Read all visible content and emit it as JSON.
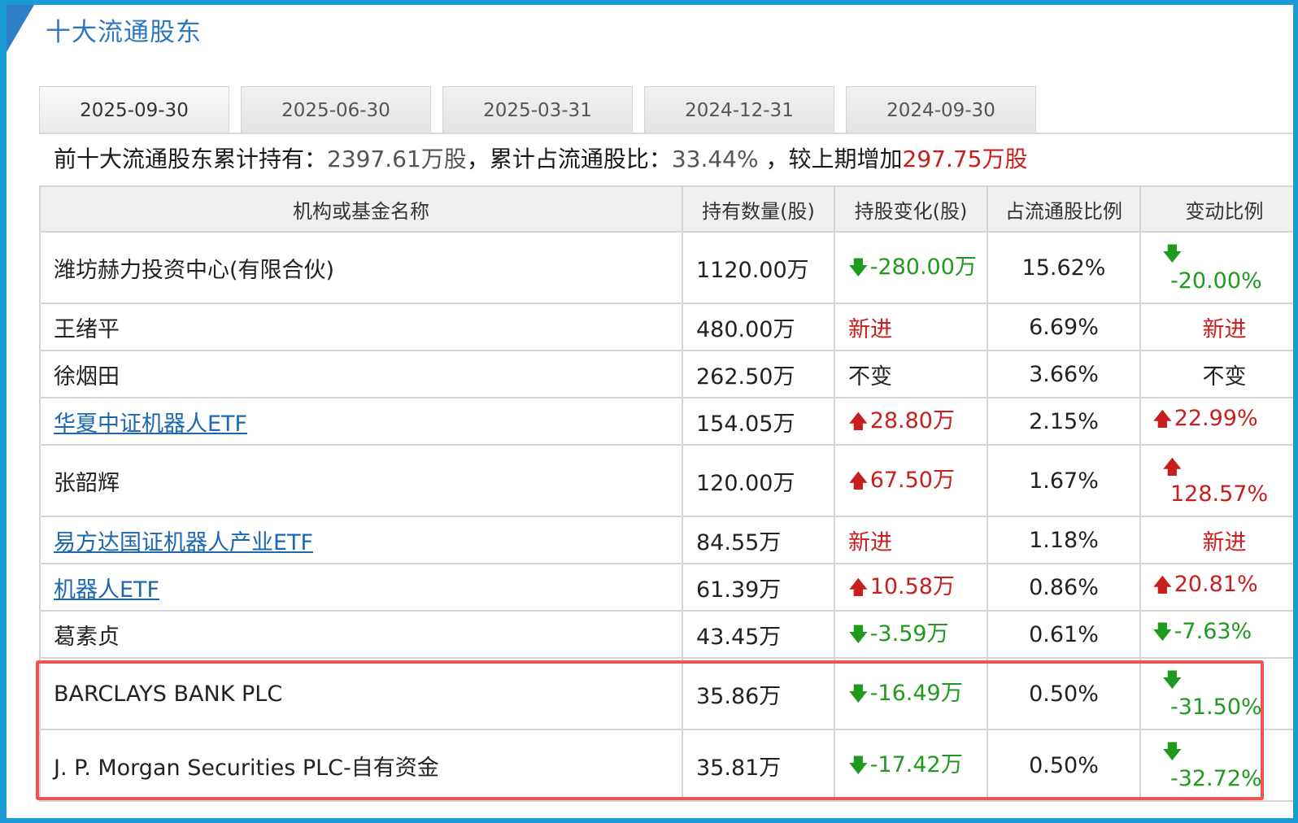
{
  "title": "十大流通股东",
  "tabs": [
    "2025-09-30",
    "2025-06-30",
    "2025-03-31",
    "2024-12-31",
    "2024-09-30"
  ],
  "summary": {
    "prefix": "前十大流通股东累计持有：",
    "total_shares": "2397.61万股",
    "sep1": "，累计占流通股比：",
    "ratio": "33.44%",
    "sep2": " ，较上期增加",
    "increase": "297.75万股"
  },
  "headers": [
    "机构或基金名称",
    "持有数量(股)",
    "持股变化(股)",
    "占流通股比例",
    "变动比例"
  ],
  "rows": [
    {
      "name": "潍坊赫力投资中心(有限合伙)",
      "link": false,
      "hold": "1120.00万",
      "change": "-280.00万",
      "dir": "down",
      "ratio": "15.62%",
      "pct": "-20.00%",
      "stack": true
    },
    {
      "name": "王绪平",
      "link": false,
      "hold": "480.00万",
      "change": "新进",
      "dir": "new",
      "ratio": "6.69%",
      "pct": "新进",
      "stack": false
    },
    {
      "name": "徐烟田",
      "link": false,
      "hold": "262.50万",
      "change": "不变",
      "dir": "same",
      "ratio": "3.66%",
      "pct": "不变",
      "stack": false
    },
    {
      "name": "华夏中证机器人ETF",
      "link": true,
      "hold": "154.05万",
      "change": "28.80万",
      "dir": "up",
      "ratio": "2.15%",
      "pct": "22.99%",
      "stack": false
    },
    {
      "name": "张韶辉",
      "link": false,
      "hold": "120.00万",
      "change": "67.50万",
      "dir": "up",
      "ratio": "1.67%",
      "pct": "128.57%",
      "stack": true
    },
    {
      "name": "易方达国证机器人产业ETF",
      "link": true,
      "hold": "84.55万",
      "change": "新进",
      "dir": "new",
      "ratio": "1.18%",
      "pct": "新进",
      "stack": false
    },
    {
      "name": "机器人ETF",
      "link": true,
      "hold": "61.39万",
      "change": "10.58万",
      "dir": "up",
      "ratio": "0.86%",
      "pct": "20.81%",
      "stack": false
    },
    {
      "name": "葛素贞",
      "link": false,
      "hold": "43.45万",
      "change": "-3.59万",
      "dir": "down",
      "ratio": "0.61%",
      "pct": "-7.63%",
      "stack": false
    },
    {
      "name": "BARCLAYS BANK PLC",
      "link": false,
      "hold": "35.86万",
      "change": "-16.49万",
      "dir": "down",
      "ratio": "0.50%",
      "pct": "-31.50%",
      "stack": true
    },
    {
      "name": "J. P. Morgan Securities PLC-自有资金",
      "link": false,
      "hold": "35.81万",
      "change": "-17.42万",
      "dir": "down",
      "ratio": "0.50%",
      "pct": "-32.72%",
      "stack": true
    }
  ],
  "colors": {
    "up": "#c81e1e",
    "down": "#1f9a1f",
    "link": "#1d66b0",
    "highlight": "#ef5350",
    "accent": "#2f7fc6"
  }
}
